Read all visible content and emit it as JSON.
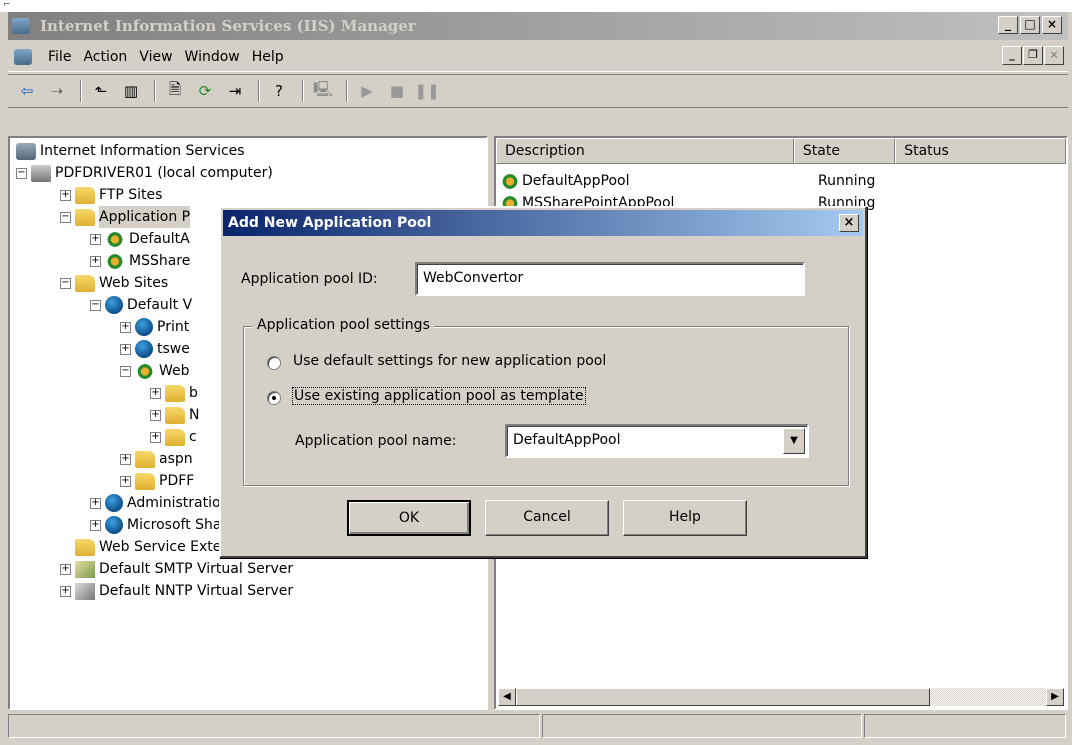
{
  "window": {
    "title": "Internet Information Services (IIS) Manager"
  },
  "menu": [
    "File",
    "Action",
    "View",
    "Window",
    "Help"
  ],
  "tree": [
    {
      "label": "Internet Information Services"
    },
    {
      "label": "PDFDRIVER01 (local computer)"
    },
    {
      "label": "FTP Sites"
    },
    {
      "label": "Application P"
    },
    {
      "label": "DefaultA"
    },
    {
      "label": "MSShare"
    },
    {
      "label": "Web Sites"
    },
    {
      "label": "Default V"
    },
    {
      "label": "Print"
    },
    {
      "label": "tswe"
    },
    {
      "label": "Web"
    },
    {
      "label": "b"
    },
    {
      "label": "N"
    },
    {
      "label": "c"
    },
    {
      "label": "aspn"
    },
    {
      "label": "PDFF"
    },
    {
      "label": "Administration"
    },
    {
      "label": "Microsoft SharePoint Administration"
    },
    {
      "label": "Web Service Extensions"
    },
    {
      "label": "Default SMTP Virtual Server"
    },
    {
      "label": "Default NNTP Virtual Server"
    }
  ],
  "list": {
    "columns": [
      "Description",
      "State",
      "Status"
    ],
    "rows": [
      {
        "description": "DefaultAppPool",
        "state": "Running",
        "status": ""
      },
      {
        "description": "MSSharePointAppPool",
        "state": "Running",
        "status": ""
      }
    ]
  },
  "dialog": {
    "title": "Add New Application Pool",
    "pool_id_label": "Application pool ID:",
    "pool_id_value": "WebConvertor",
    "group_label": "Application pool settings",
    "radio_default": "Use default settings for new application pool",
    "radio_existing": "Use existing application pool as template",
    "pool_name_label": "Application pool name:",
    "pool_name_value": "DefaultAppPool",
    "ok": "OK",
    "cancel": "Cancel",
    "help": "Help"
  },
  "colors": {
    "dialog_title": "#0a246a",
    "window_face": "#d4d0c8"
  }
}
